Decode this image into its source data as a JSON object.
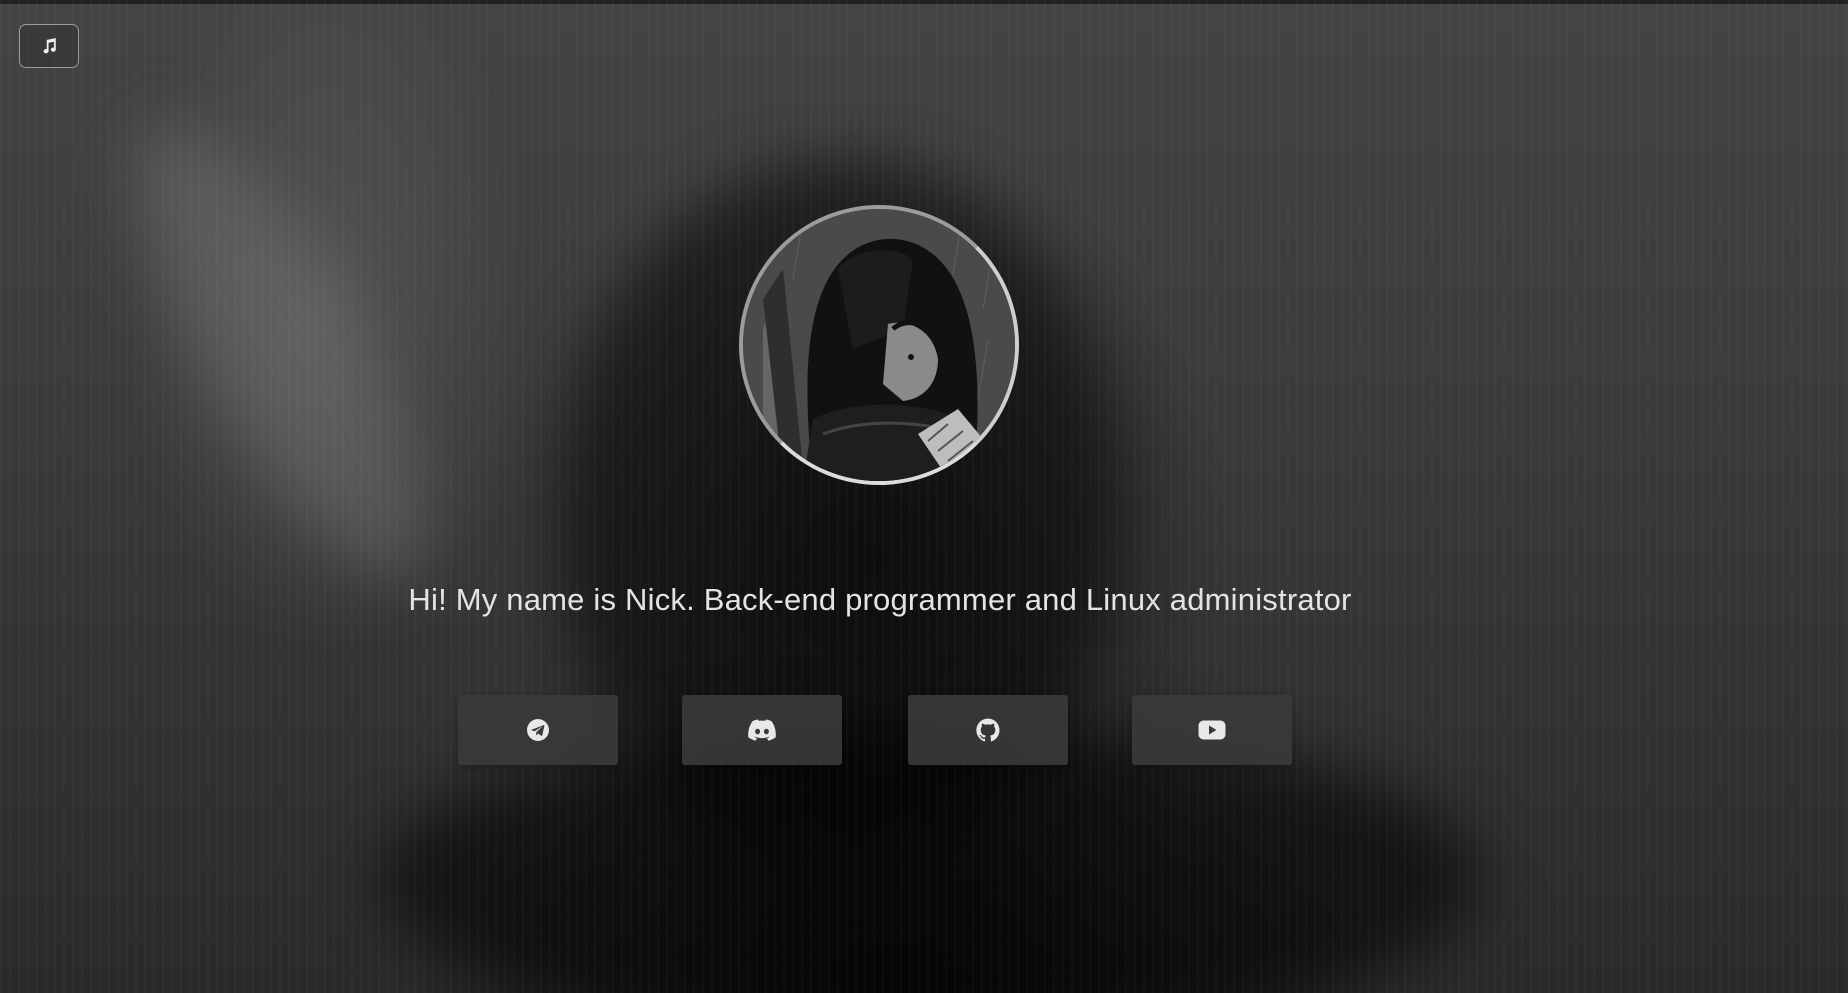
{
  "music": {
    "icon": "music-note-icon"
  },
  "profile": {
    "avatar": "hooded-swordsman-avatar"
  },
  "intro": {
    "text": "Hi! My name is Nick. Back-end programmer and Linux administrator"
  },
  "socials": [
    {
      "name": "Telegram",
      "icon": "telegram-icon"
    },
    {
      "name": "Discord",
      "icon": "discord-icon"
    },
    {
      "name": "GitHub",
      "icon": "github-icon"
    },
    {
      "name": "YouTube",
      "icon": "youtube-icon"
    }
  ],
  "colors": {
    "text": "#e4e4e4",
    "button": "#3a3a3a",
    "icon": "#e8e8e8"
  }
}
